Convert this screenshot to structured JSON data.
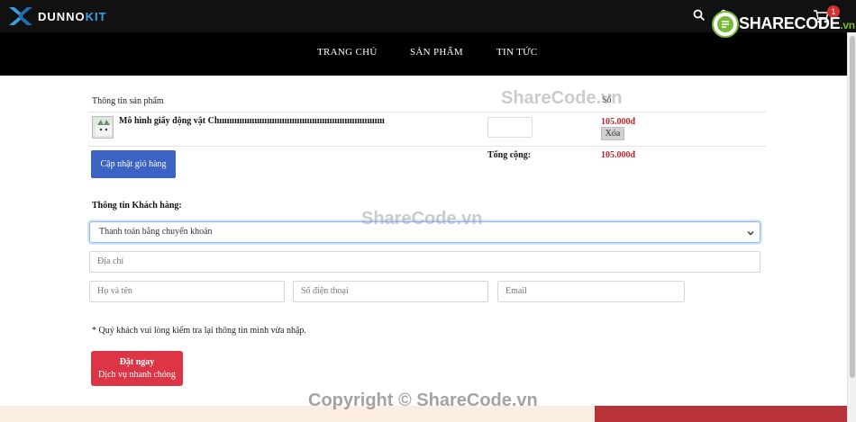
{
  "header": {
    "logo_text_main": "DUNNO",
    "logo_text_accent": "KIT",
    "cart_count": "1",
    "icons": [
      "search-icon",
      "user-icon",
      "cart-icon"
    ]
  },
  "nav": {
    "items": [
      {
        "label": "TRANG CHỦ"
      },
      {
        "label": "SẢN PHẨM"
      },
      {
        "label": "TIN TỨC"
      }
    ]
  },
  "cart": {
    "header_label": "Thông tin sản phẩm",
    "header_qty_label": "Số",
    "items": [
      {
        "name": "Mô hình giấy động vật Chıııııııııııııııııııııııııııııııııııııııııııııııııııııııııııııııııı",
        "quantity": "",
        "price": "105.000đ",
        "delete_label": "Xóa"
      }
    ],
    "update_button_label": "Cập nhật giỏ hàng",
    "total_label": "Tổng cộng:",
    "total_value": "105.000đ"
  },
  "customer": {
    "section_title": "Thông tin Khách hàng:",
    "payment_selected": "Thanh toán bằng chuyển khoản",
    "address_placeholder": "Địa chỉ",
    "name_placeholder": "Họ và tên",
    "phone_placeholder": "Số điện thoại",
    "email_placeholder": "Email",
    "note": "* Quý khách vui lòng kiểm tra lại thông tin mình vừa nhập.",
    "order_button_line1": "Đặt ngay",
    "order_button_line2": "Dịch vụ nhanh chóng"
  },
  "watermarks": {
    "top": "ShareCode.vn",
    "middle": "ShareCode.vn",
    "copyright": "Copyright © ShareCode.vn",
    "badge_main": "SHARECODE",
    "badge_suffix": ".vn"
  },
  "colors": {
    "topbar": "#111111",
    "nav": "#000000",
    "update_button": "#3b63c4",
    "order_button": "#dc3545",
    "price": "#c0262c"
  }
}
